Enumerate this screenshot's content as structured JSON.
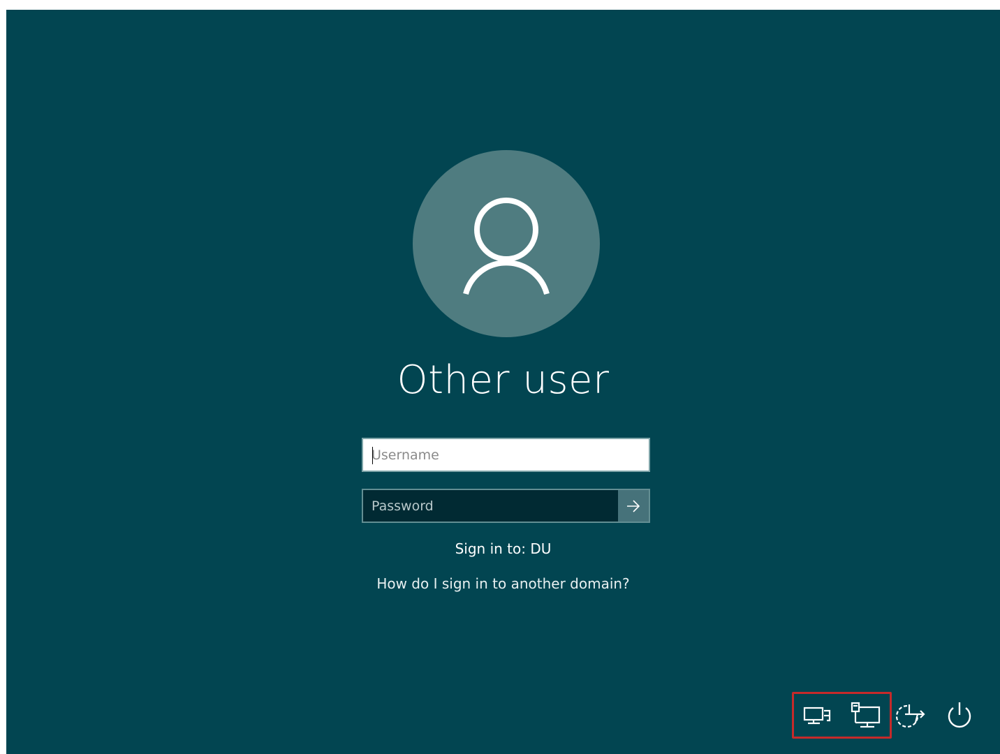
{
  "login": {
    "user_name": "Other user",
    "username_placeholder": "Username",
    "password_placeholder": "Password",
    "sign_in_to": "Sign in to: DU",
    "domain_help_link": "How do I sign in to another domain?"
  },
  "tray": {
    "icons": [
      "network-icon",
      "remote-desktop-icon",
      "ease-of-access-icon",
      "power-icon"
    ]
  },
  "colors": {
    "background": "#024551",
    "avatar": "#4f7c80",
    "highlight": "#c62a2a"
  }
}
